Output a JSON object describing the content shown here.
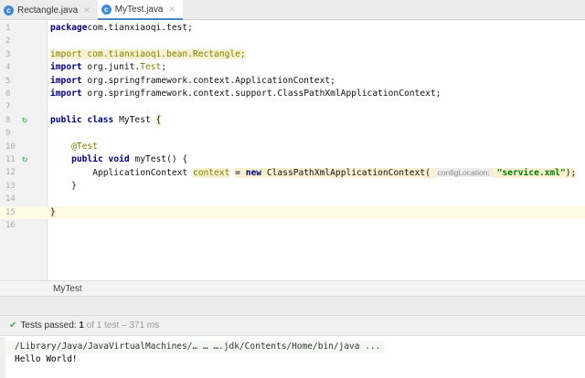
{
  "tabs": [
    {
      "label": "Rectangle.java",
      "active": false
    },
    {
      "label": "MyTest.java",
      "active": true
    }
  ],
  "editor": {
    "lines": [
      {
        "n": "1",
        "tokens": [
          [
            "kw",
            "package"
          ],
          [
            "",
            "com.tianxiaoqi.test;"
          ]
        ]
      },
      {
        "n": "2",
        "tokens": []
      },
      {
        "n": "3",
        "tokens": [
          [
            "hl an",
            "import com.tianxiaoqi.bean.Rectangle;"
          ]
        ]
      },
      {
        "n": "4",
        "tokens": [
          [
            "kw",
            "import"
          ],
          [
            "",
            " org.junit."
          ],
          [
            "an",
            "Test"
          ],
          [
            "",
            ";"
          ]
        ]
      },
      {
        "n": "5",
        "tokens": [
          [
            "kw",
            "import"
          ],
          [
            "",
            " org.springframework.context.ApplicationContext;"
          ]
        ]
      },
      {
        "n": "6",
        "tokens": [
          [
            "kw",
            "import"
          ],
          [
            "",
            " org.springframework.context.support.ClassPathXmlApplicationContext;"
          ]
        ]
      },
      {
        "n": "7",
        "tokens": []
      },
      {
        "n": "8",
        "run": true,
        "tokens": [
          [
            "kw",
            "public class"
          ],
          [
            "",
            " MyTest "
          ],
          [
            "hl",
            "{"
          ]
        ]
      },
      {
        "n": "9",
        "tokens": []
      },
      {
        "n": "10",
        "tokens": [
          [
            "",
            "    "
          ],
          [
            "an",
            "@Test"
          ]
        ]
      },
      {
        "n": "11",
        "run": true,
        "tokens": [
          [
            "",
            "    "
          ],
          [
            "kw",
            "public void"
          ],
          [
            "",
            " myTest() {"
          ]
        ]
      },
      {
        "n": "12",
        "tokens": [
          [
            "",
            "        ApplicationContext "
          ],
          [
            "hl an",
            "context"
          ],
          [
            "",
            " "
          ],
          [
            "hl",
            "= "
          ],
          [
            "hl kw",
            "new"
          ],
          [
            "hl",
            " ClassPathXmlApplicationContext( "
          ],
          [
            "hint",
            "configLocation:"
          ],
          [
            "hl",
            " "
          ],
          [
            "hl st",
            "\"service.xml\""
          ],
          [
            "hl",
            ");"
          ]
        ]
      },
      {
        "n": "13",
        "tokens": [
          [
            "",
            "    }"
          ]
        ]
      },
      {
        "n": "14",
        "tokens": []
      },
      {
        "n": "15",
        "current": true,
        "tokens": [
          [
            "hl",
            "}"
          ]
        ]
      },
      {
        "n": "16",
        "tokens": []
      }
    ]
  },
  "breadcrumb": "MyTest",
  "status": {
    "prefix": "Tests passed: ",
    "count": "1",
    "rest": " of 1 test – 371 ms"
  },
  "console": {
    "command": "/Library/Java/JavaVirtualMachines/… … ….jdk/Contents/Home/bin/java ...",
    "output": "Hello World!"
  }
}
